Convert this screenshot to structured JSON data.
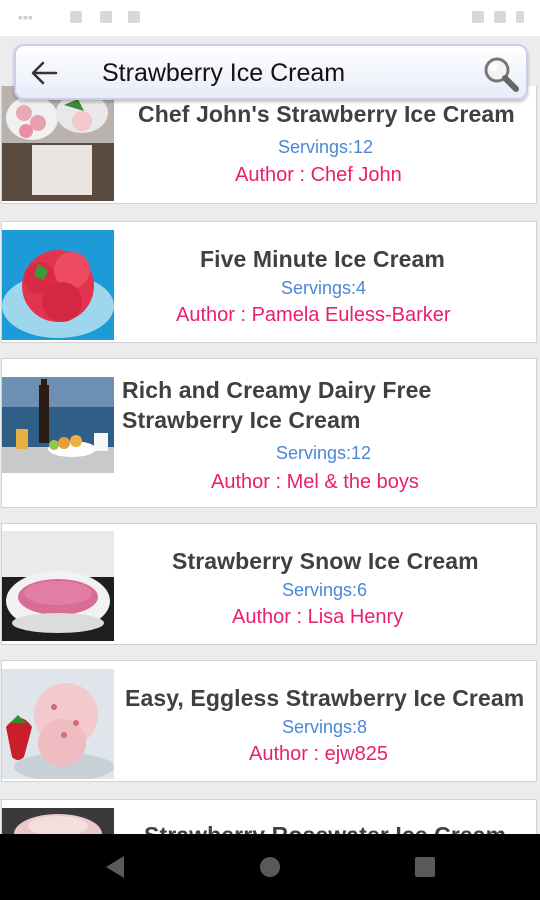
{
  "search": {
    "query": "Strawberry Ice Cream"
  },
  "recipes": [
    {
      "title": "Chef John's Strawberry Ice Cream",
      "servings": "Servings:12",
      "author": "Author : Chef John"
    },
    {
      "title": "Five Minute Ice Cream",
      "servings": "Servings:4",
      "author": "Author : Pamela Euless-Barker"
    },
    {
      "title_line1": "Rich and Creamy Dairy Free",
      "title_line2": "Strawberry Ice Cream",
      "servings": "Servings:12",
      "author": "Author : Mel & the boys"
    },
    {
      "title": "Strawberry Snow Ice Cream",
      "servings": "Servings:6",
      "author": "Author : Lisa Henry"
    },
    {
      "title": "Easy, Eggless Strawberry Ice Cream",
      "servings": "Servings:8",
      "author": "Author : ejw825"
    },
    {
      "title": "Strawberry Rosewater Ice Cream"
    }
  ],
  "colors": {
    "servings": "#4a86d8",
    "author": "#e91e70",
    "title": "#404040"
  },
  "icons": {
    "back": "arrow-left-icon",
    "search": "magnifier-icon",
    "nav": [
      "back-triangle-icon",
      "home-circle-icon",
      "recents-square-icon"
    ]
  }
}
